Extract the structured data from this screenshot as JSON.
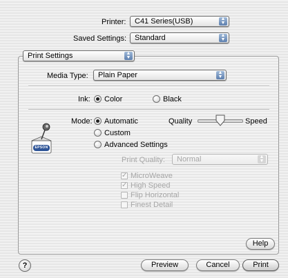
{
  "printer": {
    "label": "Printer:",
    "value": "C41 Series(USB)"
  },
  "saved_settings": {
    "label": "Saved Settings:",
    "value": "Standard"
  },
  "panel_selector": {
    "value": "Print Settings"
  },
  "media_type": {
    "label": "Media Type:",
    "value": "Plain Paper"
  },
  "ink": {
    "label": "Ink:",
    "options": [
      "Color",
      "Black"
    ],
    "selected": "Color"
  },
  "mode": {
    "label": "Mode:",
    "options": [
      "Automatic",
      "Custom",
      "Advanced Settings"
    ],
    "selected": "Automatic",
    "quality_label": "Quality",
    "speed_label": "Speed",
    "slider_level": 0.5
  },
  "logo_text": "EPSON",
  "advanced": {
    "print_quality_label": "Print Quality:",
    "print_quality_value": "Normal",
    "checkboxes": [
      {
        "label": "MicroWeave",
        "checked": true
      },
      {
        "label": "High Speed",
        "checked": true
      },
      {
        "label": "Flip Horizontal",
        "checked": false
      },
      {
        "label": "Finest Detail",
        "checked": false
      }
    ]
  },
  "buttons": {
    "help": "Help",
    "help_icon": "?",
    "preview": "Preview",
    "cancel": "Cancel",
    "print": "Print"
  },
  "colors": {
    "popup_arrow": "#5d7fae",
    "logo_blue": "#2f5597"
  }
}
